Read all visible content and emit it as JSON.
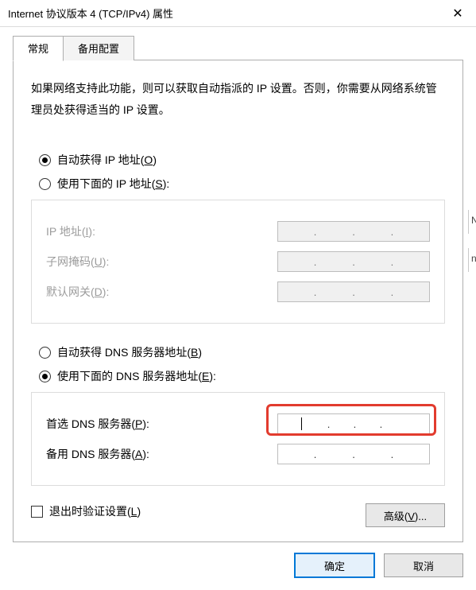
{
  "window": {
    "title": "Internet 协议版本 4 (TCP/IPv4) 属性",
    "close_glyph": "✕"
  },
  "tabs": {
    "general": "常规",
    "alternate": "备用配置"
  },
  "intro": "如果网络支持此功能，则可以获取自动指派的 IP 设置。否则，你需要从网络系统管理员处获得适当的 IP 设置。",
  "ip": {
    "auto_label_pre": "自动获得 IP 地址(",
    "auto_key": "O",
    "auto_label_post": ")",
    "manual_label_pre": "使用下面的 IP 地址(",
    "manual_key": "S",
    "manual_label_post": "):",
    "fields": {
      "ip_pre": "IP 地址(",
      "ip_key": "I",
      "ip_post": "):",
      "mask_pre": "子网掩码(",
      "mask_key": "U",
      "mask_post": "):",
      "gw_pre": "默认网关(",
      "gw_key": "D",
      "gw_post": "):"
    }
  },
  "dns": {
    "auto_label_pre": "自动获得 DNS 服务器地址(",
    "auto_key": "B",
    "auto_label_post": ")",
    "manual_label_pre": "使用下面的 DNS 服务器地址(",
    "manual_key": "E",
    "manual_label_post": "):",
    "fields": {
      "pref_pre": "首选 DNS 服务器(",
      "pref_key": "P",
      "pref_post": "):",
      "alt_pre": "备用 DNS 服务器(",
      "alt_key": "A",
      "alt_post": "):"
    }
  },
  "validate": {
    "label_pre": "退出时验证设置(",
    "key": "L",
    "label_post": ")"
  },
  "buttons": {
    "advanced_pre": "高级(",
    "advanced_key": "V",
    "advanced_post": ")...",
    "ok": "确定",
    "cancel": "取消"
  },
  "side": {
    "n1": "N",
    "n2": "n"
  }
}
